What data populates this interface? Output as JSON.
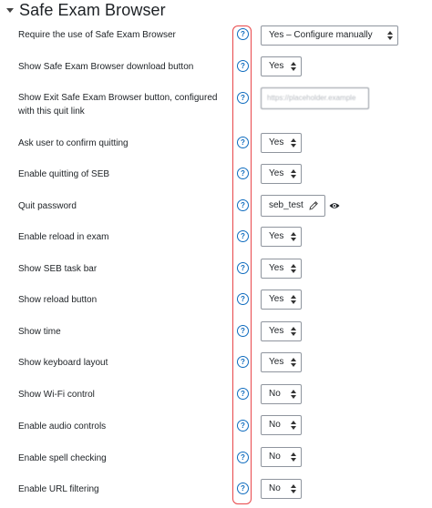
{
  "section": {
    "title": "Safe Exam Browser"
  },
  "help_glyph": "?",
  "rows": [
    {
      "label": "Require the use of Safe Exam Browser",
      "value": "Yes – Configure manually"
    },
    {
      "label": "Show Safe Exam Browser download button",
      "value": "Yes"
    },
    {
      "label": "Show Exit Safe Exam Browser button, configured with this quit link",
      "value": "https://placeholder.example"
    },
    {
      "label": "Ask user to confirm quitting",
      "value": "Yes"
    },
    {
      "label": "Enable quitting of SEB",
      "value": "Yes"
    },
    {
      "label": "Quit password",
      "value": "seb_test"
    },
    {
      "label": "Enable reload in exam",
      "value": "Yes"
    },
    {
      "label": "Show SEB task bar",
      "value": "Yes"
    },
    {
      "label": "Show reload button",
      "value": "Yes"
    },
    {
      "label": "Show time",
      "value": "Yes"
    },
    {
      "label": "Show keyboard layout",
      "value": "Yes"
    },
    {
      "label": "Show Wi-Fi control",
      "value": "No"
    },
    {
      "label": "Enable audio controls",
      "value": "No"
    },
    {
      "label": "Enable spell checking",
      "value": "No"
    },
    {
      "label": "Enable URL filtering",
      "value": "No"
    }
  ],
  "colors": {
    "accent": "#0f6cbf",
    "highlight": "#e8474a"
  }
}
